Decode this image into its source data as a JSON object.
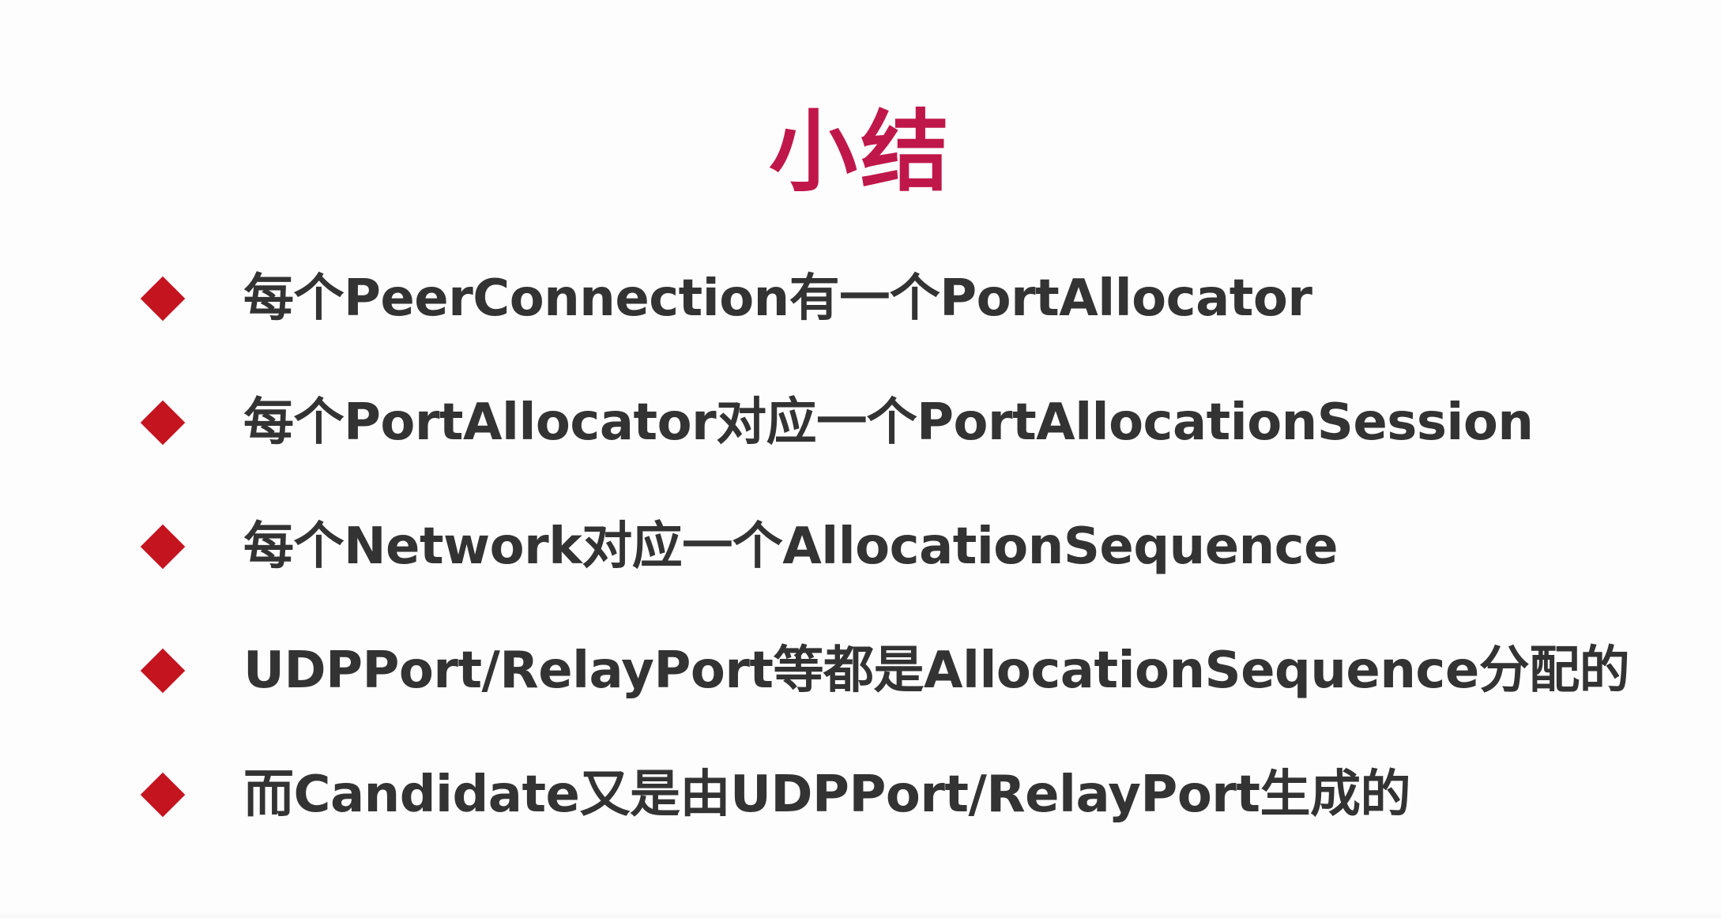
{
  "slide": {
    "title": "小结",
    "colors": {
      "title": "#c0174a",
      "bullet_marker": "#c4141f",
      "text": "#333333",
      "background": "#fdfdfd"
    },
    "bullet_icon": "diamond-icon",
    "bullets": [
      "每个PeerConnection有一个PortAllocator",
      "每个PortAllocator对应一个PortAllocationSession",
      "每个Network对应一个AllocationSequence",
      "UDPPort/RelayPort等都是AllocationSequence分配的",
      "而Candidate又是由UDPPort/RelayPort生成的"
    ]
  }
}
